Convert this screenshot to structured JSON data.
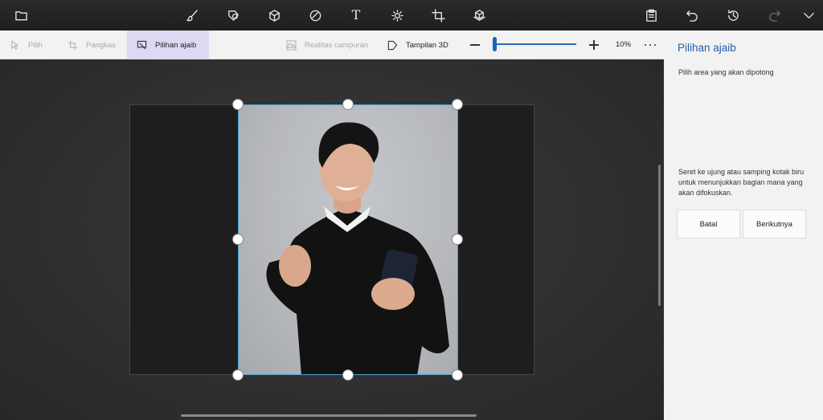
{
  "toolbar": {
    "icons": [
      "folder-icon",
      "brush-icon",
      "shapes-2d-icon",
      "shapes-3d-icon",
      "sticker-icon",
      "text-icon",
      "effects-icon",
      "crop-canvas-icon",
      "library-3d-icon",
      "paste-icon",
      "undo-icon",
      "history-icon",
      "redo-icon",
      "expand-icon"
    ],
    "text_glyph": "T"
  },
  "subbar": {
    "select_label": "Pilih",
    "crop_label": "Pangkas",
    "magic_select_label": "Pilihan ajaib",
    "mixed_reality_label": "Realitas campuran",
    "view_3d_label": "Tampilan 3D",
    "zoom_value": "10%",
    "zoom_level_fraction": 0
  },
  "panel": {
    "title": "Pilihan ajaib",
    "subtitle": "Pilih area yang akan dipotong",
    "help_text": "Seret ke ujung atau samping kotak biru untuk menunjukkan bagian mana yang akan difokuskan.",
    "cancel_label": "Batal",
    "next_label": "Berikutnya"
  },
  "colors": {
    "accent": "#1f5fa8",
    "selection_border": "#4aa3d6",
    "active_tab": "#dcd9f3"
  }
}
